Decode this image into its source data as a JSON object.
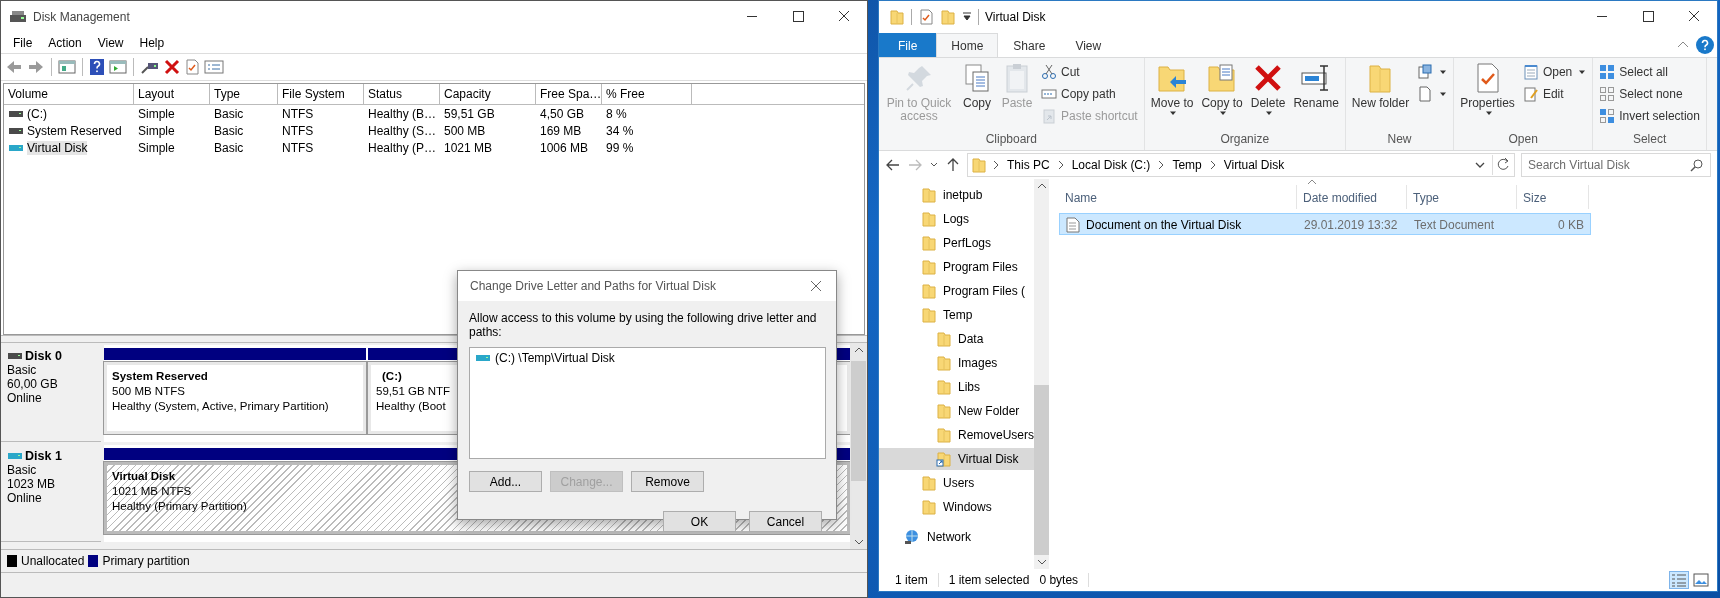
{
  "disk_management": {
    "title": "Disk Management",
    "menu": [
      "File",
      "Action",
      "View",
      "Help"
    ],
    "volume_table": {
      "columns": [
        "Volume",
        "Layout",
        "Type",
        "File System",
        "Status",
        "Capacity",
        "Free Spa…",
        "% Free"
      ],
      "rows": [
        {
          "kind": "system",
          "selected": false,
          "cells": [
            "(C:)",
            "Simple",
            "Basic",
            "NTFS",
            "Healthy (B…",
            "59,51 GB",
            "4,50 GB",
            "8 %"
          ]
        },
        {
          "kind": "system",
          "selected": false,
          "cells": [
            "System Reserved",
            "Simple",
            "Basic",
            "NTFS",
            "Healthy (S…",
            "500 MB",
            "169 MB",
            "34 %"
          ]
        },
        {
          "kind": "virtual",
          "selected": true,
          "cells": [
            "Virtual Disk",
            "Simple",
            "Basic",
            "NTFS",
            "Healthy (P…",
            "1021 MB",
            "1006 MB",
            "99 %"
          ]
        }
      ]
    },
    "disks": [
      {
        "kind": "system",
        "name": "Disk 0",
        "lines": [
          "Basic",
          "60,00 GB",
          "Online"
        ],
        "partitions": [
          {
            "title": "System Reserved",
            "lines": [
              "500 MB NTFS",
              "Healthy (System, Active, Primary Partition)"
            ],
            "hatched": false
          },
          {
            "title": "(C:)",
            "lines": [
              "59,51 GB NTF",
              "Healthy (Boot"
            ],
            "hatched": false
          }
        ]
      },
      {
        "kind": "virtual",
        "name": "Disk 1",
        "lines": [
          "Basic",
          "1023 MB",
          "Online"
        ],
        "partitions": [
          {
            "title": "Virtual Disk",
            "lines": [
              "1021 MB NTFS",
              "Healthy (Primary Partition)"
            ],
            "hatched": true
          }
        ]
      }
    ],
    "legend": [
      {
        "label": "Unallocated",
        "color": "#000000"
      },
      {
        "label": "Primary partition",
        "color": "#000080"
      }
    ]
  },
  "dialog": {
    "title": "Change Drive Letter and Paths for Virtual Disk",
    "prompt": "Allow access to this volume by using the following drive letter and paths:",
    "paths": [
      "(C:) \\Temp\\Virtual Disk"
    ],
    "buttons": [
      {
        "label": "Add...",
        "disabled": false
      },
      {
        "label": "Change...",
        "disabled": true
      },
      {
        "label": "Remove",
        "disabled": false
      }
    ],
    "footer_buttons": [
      "OK",
      "Cancel"
    ]
  },
  "explorer": {
    "title": "Virtual Disk",
    "ribbon_tabs": [
      {
        "label": "File",
        "kind": "file",
        "selected": false
      },
      {
        "label": "Home",
        "kind": "tab",
        "selected": true
      },
      {
        "label": "Share",
        "kind": "tab",
        "selected": false
      },
      {
        "label": "View",
        "kind": "tab",
        "selected": false
      }
    ],
    "ribbon_groups": [
      {
        "label": "Clipboard",
        "large": [
          {
            "label": "Pin to Quick access",
            "disabled": true,
            "dropdown": false
          },
          {
            "label": "Copy",
            "disabled": false,
            "dropdown": false
          },
          {
            "label": "Paste",
            "disabled": true,
            "dropdown": false
          }
        ],
        "small": [
          {
            "label": "Cut",
            "disabled": false,
            "dropdown": false
          },
          {
            "label": "Copy path",
            "disabled": false,
            "dropdown": false
          },
          {
            "label": "Paste shortcut",
            "disabled": true,
            "dropdown": false
          }
        ]
      },
      {
        "label": "Organize",
        "large": [
          {
            "label": "Move to",
            "disabled": false,
            "dropdown": true
          },
          {
            "label": "Copy to",
            "disabled": false,
            "dropdown": true
          },
          {
            "label": "Delete",
            "disabled": false,
            "dropdown": true
          },
          {
            "label": "Rename",
            "disabled": false,
            "dropdown": false
          }
        ]
      },
      {
        "label": "New",
        "large": [
          {
            "label": "New folder",
            "disabled": false,
            "dropdown": false
          }
        ]
      },
      {
        "label": "Open",
        "large": [
          {
            "label": "Properties",
            "disabled": false,
            "dropdown": true
          }
        ],
        "small": [
          {
            "label": "Open",
            "disabled": false,
            "dropdown": true
          },
          {
            "label": "Edit",
            "disabled": false,
            "dropdown": false
          }
        ]
      },
      {
        "label": "Select",
        "small": [
          {
            "label": "Select all",
            "disabled": false,
            "dropdown": false
          },
          {
            "label": "Select none",
            "disabled": false,
            "dropdown": false
          },
          {
            "label": "Invert selection",
            "disabled": false,
            "dropdown": false
          }
        ]
      }
    ],
    "address": [
      "This PC",
      "Local Disk (C:)",
      "Temp",
      "Virtual Disk"
    ],
    "search": {
      "placeholder": "Search Virtual Disk"
    },
    "nav": [
      {
        "label": "inetpub",
        "kind": "folder",
        "selected": false
      },
      {
        "label": "Logs",
        "kind": "folder",
        "selected": false
      },
      {
        "label": "PerfLogs",
        "kind": "folder",
        "selected": false
      },
      {
        "label": "Program Files",
        "kind": "folder",
        "selected": false
      },
      {
        "label": "Program Files (",
        "kind": "folder",
        "selected": false
      },
      {
        "label": "Temp",
        "kind": "folder",
        "selected": false,
        "children": [
          {
            "label": "Data",
            "kind": "folder",
            "selected": false
          },
          {
            "label": "Images",
            "kind": "folder",
            "selected": false
          },
          {
            "label": "Libs",
            "kind": "folder",
            "selected": false
          },
          {
            "label": "New Folder",
            "kind": "folder",
            "selected": false
          },
          {
            "label": "RemoveUsers",
            "kind": "folder",
            "selected": false
          },
          {
            "label": "Virtual Disk",
            "kind": "mount",
            "selected": true
          }
        ]
      },
      {
        "label": "Users",
        "kind": "folder",
        "selected": false
      },
      {
        "label": "Windows",
        "kind": "folder",
        "selected": false
      }
    ],
    "network": "Network",
    "columns": [
      "Name",
      "Date modified",
      "Type",
      "Size"
    ],
    "files": [
      {
        "name": "Document on the Virtual Disk",
        "date": "29.01.2019 13:32",
        "type": "Text Document",
        "size": "0 KB",
        "selected": true
      }
    ],
    "status": [
      "1 item",
      "1 item selected",
      "0 bytes"
    ]
  }
}
